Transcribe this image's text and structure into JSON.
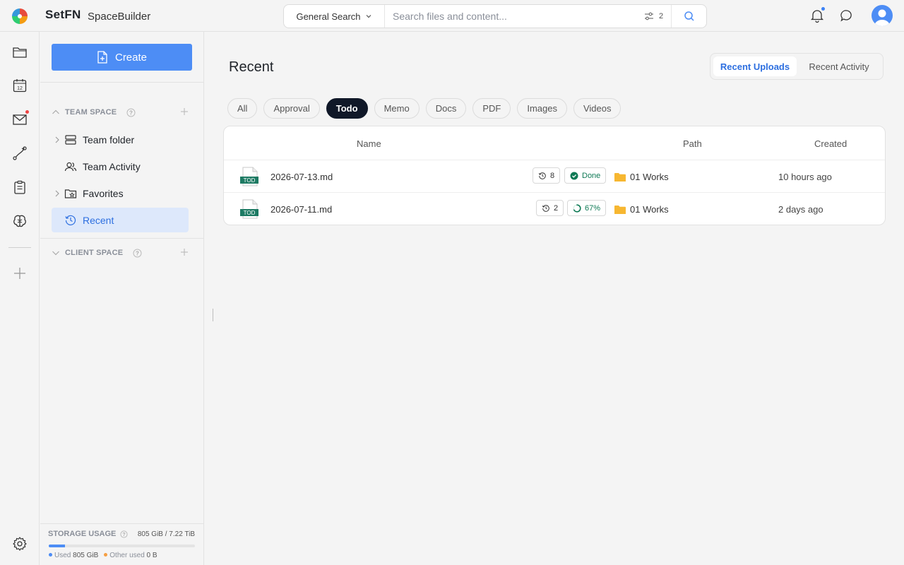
{
  "app": {
    "brand": "SetFN",
    "name": "SpaceBuilder"
  },
  "search": {
    "scope": "General Search",
    "placeholder": "Search files and content...",
    "filter_count": "2"
  },
  "sidebar": {
    "create_label": "Create",
    "team_space_title": "TEAM SPACE",
    "team_items": [
      {
        "label": "Team folder",
        "icon": "server-icon"
      },
      {
        "label": "Team Activity",
        "icon": "users-icon"
      },
      {
        "label": "Favorites",
        "icon": "folder-star-icon"
      },
      {
        "label": "Recent",
        "icon": "history-icon",
        "active": true
      }
    ],
    "client_space_title": "CLIENT SPACE"
  },
  "storage": {
    "title": "STORAGE USAGE",
    "total": "805 GiB / 7.22 TiB",
    "used_label": "Used",
    "used_value": "805 GiB",
    "other_label": "Other used",
    "other_value": "0 B",
    "used_fraction": 0.109,
    "used_color": "#4d8df5",
    "other_color": "#f59e42"
  },
  "main": {
    "title": "Recent",
    "tabs": [
      {
        "label": "Recent Uploads",
        "active": true
      },
      {
        "label": "Recent Activity",
        "active": false
      }
    ],
    "filters": [
      "All",
      "Approval",
      "Todo",
      "Memo",
      "Docs",
      "PDF",
      "Images",
      "Videos"
    ],
    "active_filter": "Todo",
    "columns": {
      "name": "Name",
      "path": "Path",
      "created": "Created"
    },
    "rows": [
      {
        "icon_label": "TOD",
        "name": "2026-07-13.md",
        "history": "8",
        "status": "Done",
        "path": "01 Works",
        "created": "10 hours ago"
      },
      {
        "icon_label": "TOD",
        "name": "2026-07-11.md",
        "history": "2",
        "status": "67%",
        "progress": 0.67,
        "path": "01 Works",
        "created": "2 days ago"
      }
    ]
  },
  "colors": {
    "accent": "#4d8df5",
    "accent_text": "#2d6fe0",
    "status_green": "#0f7a55",
    "file_green": "#1d7a63",
    "folder": "#f7b731"
  }
}
